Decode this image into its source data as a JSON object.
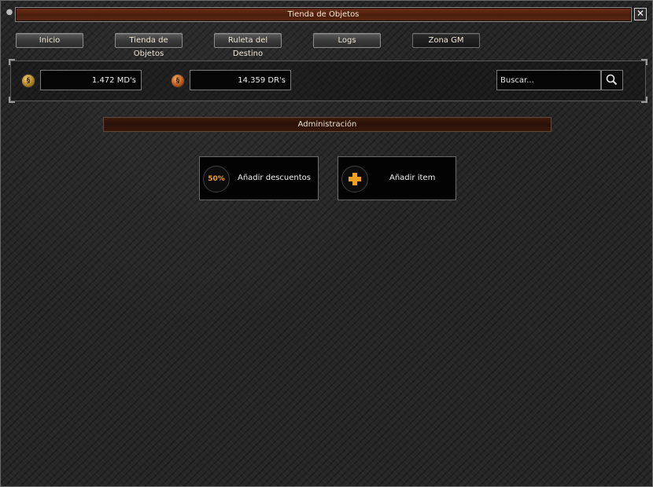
{
  "window": {
    "title": "Tienda de Objetos",
    "close_symbol": "✕"
  },
  "nav": {
    "items": [
      {
        "label": "Inicio"
      },
      {
        "label": "Tienda de Objetos"
      },
      {
        "label": "Ruleta del Destino"
      },
      {
        "label": "Logs"
      },
      {
        "label": "Zona GM",
        "active": true
      }
    ]
  },
  "currency": {
    "md": {
      "icon": "md-coin-icon",
      "value": "1.472 MD's"
    },
    "dr": {
      "icon": "dr-coin-icon",
      "value": "14.359 DR's"
    }
  },
  "search": {
    "placeholder": "Buscar...",
    "icon": "search-icon"
  },
  "admin": {
    "title": "Administración",
    "cards": [
      {
        "badge": "50%",
        "label": "Añadir descuentos",
        "icon": "discount-icon"
      },
      {
        "label": "Añadir item",
        "icon": "plus-icon"
      }
    ]
  },
  "colors": {
    "accent_orange": "#f0a020",
    "title_bar": "#5b2812"
  }
}
